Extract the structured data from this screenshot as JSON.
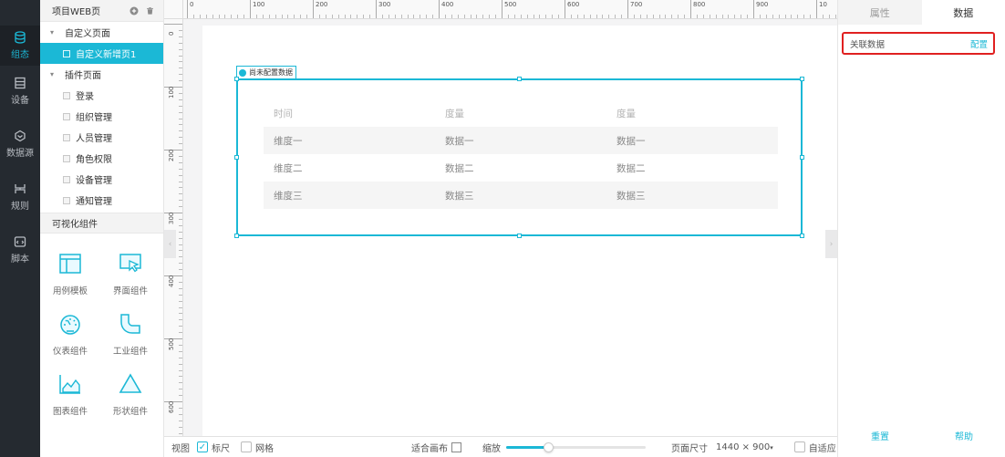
{
  "rail": [
    {
      "label": "组态",
      "icon": "database-stack-icon",
      "active": true
    },
    {
      "label": "设备",
      "icon": "device-list-icon",
      "active": false
    },
    {
      "label": "数据源",
      "icon": "data-source-icon",
      "active": false
    },
    {
      "label": "规则",
      "icon": "rule-icon",
      "active": false
    },
    {
      "label": "脚本",
      "icon": "script-icon",
      "active": false
    }
  ],
  "tree": {
    "title": "项目WEB页",
    "groups": [
      {
        "label": "自定义页面",
        "items": [
          {
            "label": "自定义新增页1",
            "selected": true
          }
        ]
      },
      {
        "label": "插件页面",
        "items": [
          {
            "label": "登录"
          },
          {
            "label": "组织管理"
          },
          {
            "label": "人员管理"
          },
          {
            "label": "角色权限"
          },
          {
            "label": "设备管理"
          },
          {
            "label": "通知管理"
          }
        ]
      }
    ],
    "viz_title": "可视化组件",
    "components": [
      {
        "label": "用例模板",
        "icon": "template-icon"
      },
      {
        "label": "界面组件",
        "icon": "ui-component-icon"
      },
      {
        "label": "仪表组件",
        "icon": "gauge-icon"
      },
      {
        "label": "工业组件",
        "icon": "pipe-icon"
      },
      {
        "label": "图表组件",
        "icon": "line-chart-icon"
      },
      {
        "label": "形状组件",
        "icon": "triangle-icon"
      }
    ]
  },
  "ruler": {
    "h_labels": [
      "0",
      "100",
      "200",
      "300",
      "400",
      "500",
      "600",
      "700",
      "800",
      "900",
      "10"
    ],
    "v_labels": [
      "0",
      "100",
      "200",
      "300",
      "400",
      "500",
      "600"
    ]
  },
  "widget": {
    "tag": "尚未配置数据",
    "headers": [
      "时间",
      "度量",
      "度量"
    ],
    "rows": [
      [
        "维度一",
        "数据一",
        "数据一"
      ],
      [
        "维度二",
        "数据二",
        "数据二"
      ],
      [
        "维度三",
        "数据三",
        "数据三"
      ]
    ]
  },
  "bottom": {
    "view": "视图",
    "ruler": "标尺",
    "ruler_checked": true,
    "grid": "网格",
    "grid_checked": false,
    "fit": "适合画布",
    "zoom": "缩放",
    "zoom_value": 0.3,
    "page_size_label": "页面尺寸",
    "page_size_value": "1440 × 900",
    "adapt": "自适应",
    "adapt_checked": false
  },
  "right": {
    "tabs": [
      "属性",
      "数据"
    ],
    "active_tab": 1,
    "link_label": "关联数据",
    "config_label": "配置",
    "reset": "重置",
    "help": "帮助"
  },
  "colors": {
    "accent": "#1bb8d6",
    "rail": "#252a30",
    "highlight": "#e02020"
  }
}
